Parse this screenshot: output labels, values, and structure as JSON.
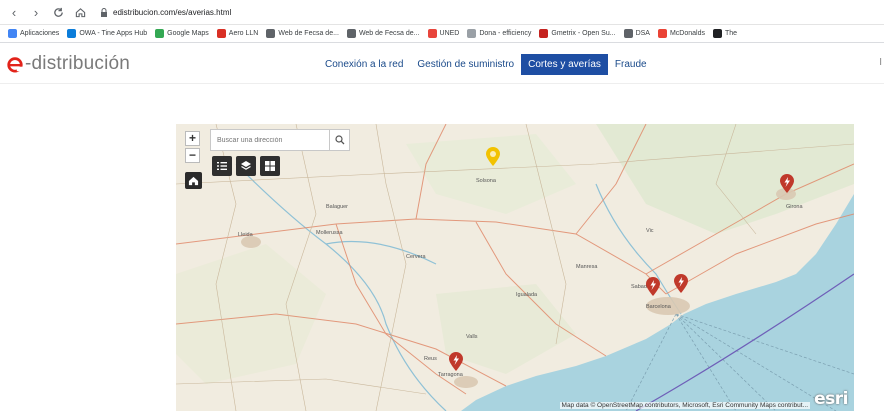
{
  "browser": {
    "url": "edistribucion.com/es/averias.html",
    "bookmarks": [
      {
        "label": "Aplicaciones",
        "color": "#4285f4"
      },
      {
        "label": "OWA - Tine Apps Hub",
        "color": "#0b7dda"
      },
      {
        "label": "Google Maps",
        "color": "#34a853"
      },
      {
        "label": "Aero LLN",
        "color": "#d93025"
      },
      {
        "label": "Web de Fecsa de...",
        "color": "#5f6368"
      },
      {
        "label": "Web de Fecsa de...",
        "color": "#5f6368"
      },
      {
        "label": "UNED",
        "color": "#e8453c"
      },
      {
        "label": "Dona - efficiency",
        "color": "#9aa0a6"
      },
      {
        "label": "Gmetrix - Open Su...",
        "color": "#c5221f"
      },
      {
        "label": "DSA",
        "color": "#5f6368"
      },
      {
        "label": "McDonalds",
        "color": "#ea4335"
      },
      {
        "label": "The",
        "color": "#202124"
      }
    ]
  },
  "site": {
    "logo_text": "-distribución",
    "brand_color": "#e2231a",
    "nav": [
      {
        "label": "Conexión a la red",
        "active": false
      },
      {
        "label": "Gestión de suministro",
        "active": false
      },
      {
        "label": "Cortes y averías",
        "active": true
      },
      {
        "label": "Fraude",
        "active": false
      }
    ],
    "header_right": "I"
  },
  "map": {
    "search_placeholder": "Buscar una dirección",
    "zoom_in": "+",
    "zoom_out": "−",
    "attribution": "Map data © OpenStreetMap contributors, Microsoft, Esri Community Maps contribut...",
    "esri_logo": "esri",
    "pin_color": "#c0392b",
    "warning_pin_color": "#f2c200",
    "cities": [
      "Lleida",
      "Tarragona",
      "Barcelona",
      "Girona",
      "Manresa",
      "Reus",
      "Sabadell",
      "Vic",
      "Igualada",
      "Balaguer",
      "Mollerussa",
      "Cervera",
      "Valls",
      "Solsona"
    ]
  }
}
